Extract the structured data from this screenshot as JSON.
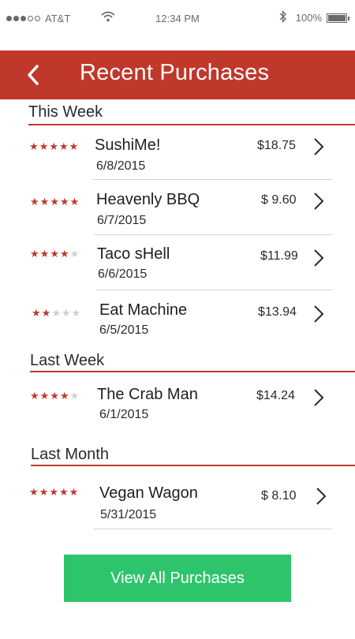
{
  "status": {
    "carrier": "AT&T",
    "time": "12:34 PM",
    "battery": "100%",
    "signal_bars": 3,
    "signal_total": 5
  },
  "header": {
    "title": "Recent Purchases"
  },
  "sections": [
    {
      "title": "This Week"
    },
    {
      "title": "Last Week"
    },
    {
      "title": "Last Month"
    }
  ],
  "purchases": [
    {
      "name": "SushiMe!",
      "date": "6/8/2015",
      "price": "$18.75",
      "rating": 5
    },
    {
      "name": "Heavenly BBQ",
      "date": "6/7/2015",
      "price": "$ 9.60",
      "rating": 5
    },
    {
      "name": "Taco sHell",
      "date": "6/6/2015",
      "price": "$11.99",
      "rating": 4
    },
    {
      "name": "Eat Machine",
      "date": "6/5/2015",
      "price": "$13.94",
      "rating": 2
    },
    {
      "name": "The Crab Man",
      "date": "6/1/2015",
      "price": "$14.24",
      "rating": 4
    },
    {
      "name": "Vegan Wagon",
      "date": "5/31/2015",
      "price": "$ 8.10",
      "rating": 5
    }
  ],
  "cta": {
    "label": "View All Purchases"
  },
  "colors": {
    "accent": "#c0382b",
    "cta": "#2ec46c",
    "star_off": "#cfcfcf"
  },
  "icons": [
    "back-chevron-icon",
    "chevron-right-icon",
    "wifi-icon",
    "bluetooth-icon",
    "battery-icon",
    "star-icon"
  ]
}
